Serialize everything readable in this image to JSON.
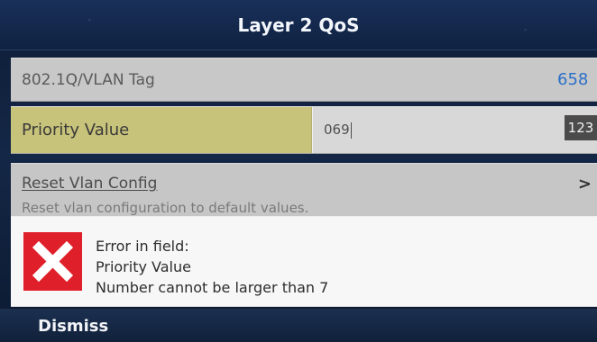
{
  "titlebar": {
    "title": "Layer 2 QoS"
  },
  "rows": {
    "vlan": {
      "label": "802.1Q/VLAN Tag",
      "value": "658"
    },
    "priority": {
      "label": "Priority Value",
      "value": "069",
      "input_mode": "123"
    },
    "reset": {
      "title": "Reset Vlan Config",
      "subtitle": "Reset vlan configuration to default values.",
      "chevron": ">"
    }
  },
  "error": {
    "line1": "Error in field:",
    "line2": "Priority Value",
    "line3": "Number cannot be larger than 7",
    "icon": "error-x-icon",
    "colors": {
      "icon_bg": "#df1f2a",
      "icon_fg": "#ffffff"
    }
  },
  "footer": {
    "dismiss_label": "Dismiss"
  },
  "colors": {
    "background": "#10213a",
    "title_bg": "#19305a",
    "priority_highlight": "#c8c37a",
    "vlan_value": "#2a6fc9"
  }
}
